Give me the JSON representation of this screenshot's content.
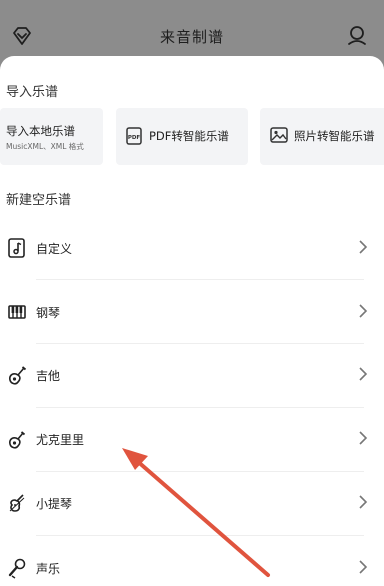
{
  "header": {
    "title": "来音制谱",
    "left_icon": "diamond-icon",
    "right_icon": "user-icon"
  },
  "import_section": {
    "title": "导入乐谱",
    "cards": [
      {
        "label": "导入本地乐谱",
        "sub": "MusicXML、XML 格式"
      },
      {
        "label": "PDF转智能乐谱",
        "icon": "pdf-icon"
      },
      {
        "label": "照片转智能乐谱",
        "icon": "image-icon"
      }
    ]
  },
  "new_section": {
    "title": "新建空乐谱",
    "items": [
      {
        "label": "自定义",
        "icon": "music-note-icon"
      },
      {
        "label": "钢琴",
        "icon": "piano-icon"
      },
      {
        "label": "吉他",
        "icon": "guitar-icon"
      },
      {
        "label": "尤克里里",
        "icon": "ukulele-icon"
      },
      {
        "label": "小提琴",
        "icon": "violin-icon"
      },
      {
        "label": "声乐",
        "icon": "microphone-icon"
      }
    ]
  },
  "annotation": {
    "color": "#e0543e"
  }
}
